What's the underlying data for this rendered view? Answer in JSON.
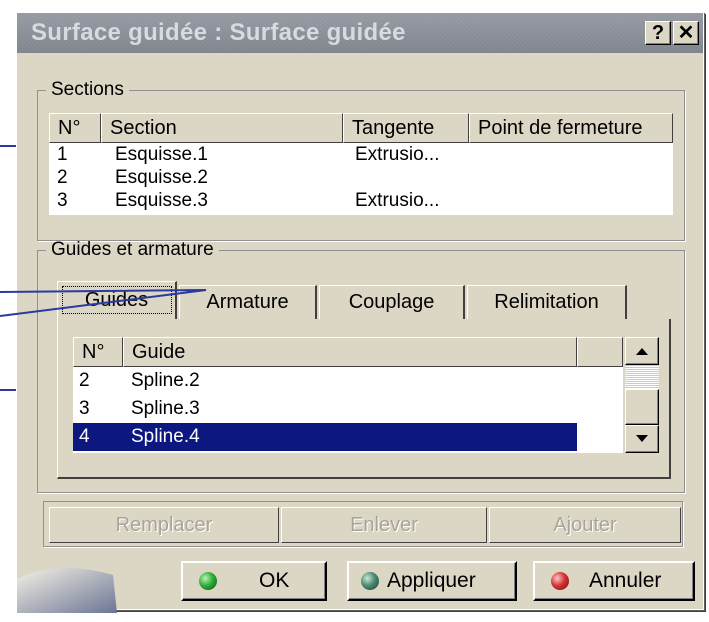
{
  "dialog": {
    "title": "Surface guidée : Surface guidée",
    "help_label": "?",
    "close_label": "✕"
  },
  "sections": {
    "legend": "Sections",
    "columns": [
      "N°",
      "Section",
      "Tangente",
      "Point de fermeture"
    ],
    "rows": [
      {
        "num": "1",
        "section": "Esquisse.1",
        "tangent": "Extrusio...",
        "closing": ""
      },
      {
        "num": "2",
        "section": "Esquisse.2",
        "tangent": "",
        "closing": ""
      },
      {
        "num": "3",
        "section": "Esquisse.3",
        "tangent": "Extrusio...",
        "closing": ""
      }
    ]
  },
  "guides": {
    "legend": "Guides et armature",
    "tabs": [
      {
        "label": "Guides"
      },
      {
        "label": "Armature"
      },
      {
        "label": "Couplage"
      },
      {
        "label": "Relimitation"
      }
    ],
    "columns": [
      "N°",
      "Guide"
    ],
    "rows": [
      {
        "num": "2",
        "guide": "Spline.2",
        "selected": false
      },
      {
        "num": "3",
        "guide": "Spline.3",
        "selected": false
      },
      {
        "num": "4",
        "guide": "Spline.4",
        "selected": true
      }
    ]
  },
  "actions": {
    "replace": "Remplacer",
    "remove": "Enlever",
    "add": "Ajouter"
  },
  "buttons": {
    "ok": "OK",
    "apply": "Appliquer",
    "cancel": "Annuler"
  },
  "colors": {
    "selection": "#0c1780",
    "ok_indicator": "#2fae3a",
    "apply_indicator": "#4c8a72",
    "cancel_indicator": "#d53434",
    "callout": "#2a3aa0"
  }
}
